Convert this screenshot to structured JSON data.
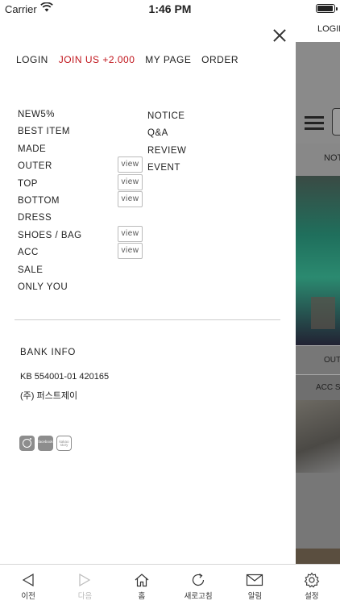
{
  "status_bar": {
    "carrier": "Carrier",
    "time": "1:46 PM"
  },
  "background_page": {
    "login_label": "LOGIN",
    "notice_label": "NOT",
    "outer_label": "OUT",
    "acc_label": "ACC SH"
  },
  "drawer": {
    "top_nav": [
      {
        "label": "LOGIN"
      },
      {
        "label": "JOIN US +2.000",
        "accent": "#c0141b"
      },
      {
        "label": "MY PAGE"
      },
      {
        "label": "ORDER"
      }
    ],
    "categories": [
      {
        "label": "NEW5%"
      },
      {
        "label": "BEST ITEM"
      },
      {
        "label": "MADE"
      },
      {
        "label": "OUTER",
        "view": "view"
      },
      {
        "label": "TOP",
        "view": "view"
      },
      {
        "label": "BOTTOM",
        "view": "view"
      },
      {
        "label": "DRESS"
      },
      {
        "label": "SHOES / BAG",
        "view": "view"
      },
      {
        "label": "ACC",
        "view": "view"
      },
      {
        "label": "SALE"
      },
      {
        "label": "ONLY YOU"
      }
    ],
    "community": [
      "NOTICE",
      "Q&A",
      "REVIEW",
      "EVENT"
    ],
    "bank": {
      "title": "BANK INFO",
      "account": "KB 554001-01 420165",
      "holder": "(주) 퍼스트제이"
    },
    "social": [
      {
        "icon": "instagram-icon"
      },
      {
        "icon": "facebook-icon",
        "text": "facebook"
      },
      {
        "icon": "kakaostory-icon",
        "text": "kakao story"
      }
    ]
  },
  "toolbar": {
    "items": [
      {
        "label": "이전",
        "icon": "back-icon"
      },
      {
        "label": "다음",
        "icon": "forward-icon",
        "disabled": true
      },
      {
        "label": "홈",
        "icon": "home-icon"
      },
      {
        "label": "새로고침",
        "icon": "refresh-icon"
      },
      {
        "label": "알림",
        "icon": "mail-icon"
      },
      {
        "label": "설정",
        "icon": "gear-icon"
      }
    ]
  }
}
